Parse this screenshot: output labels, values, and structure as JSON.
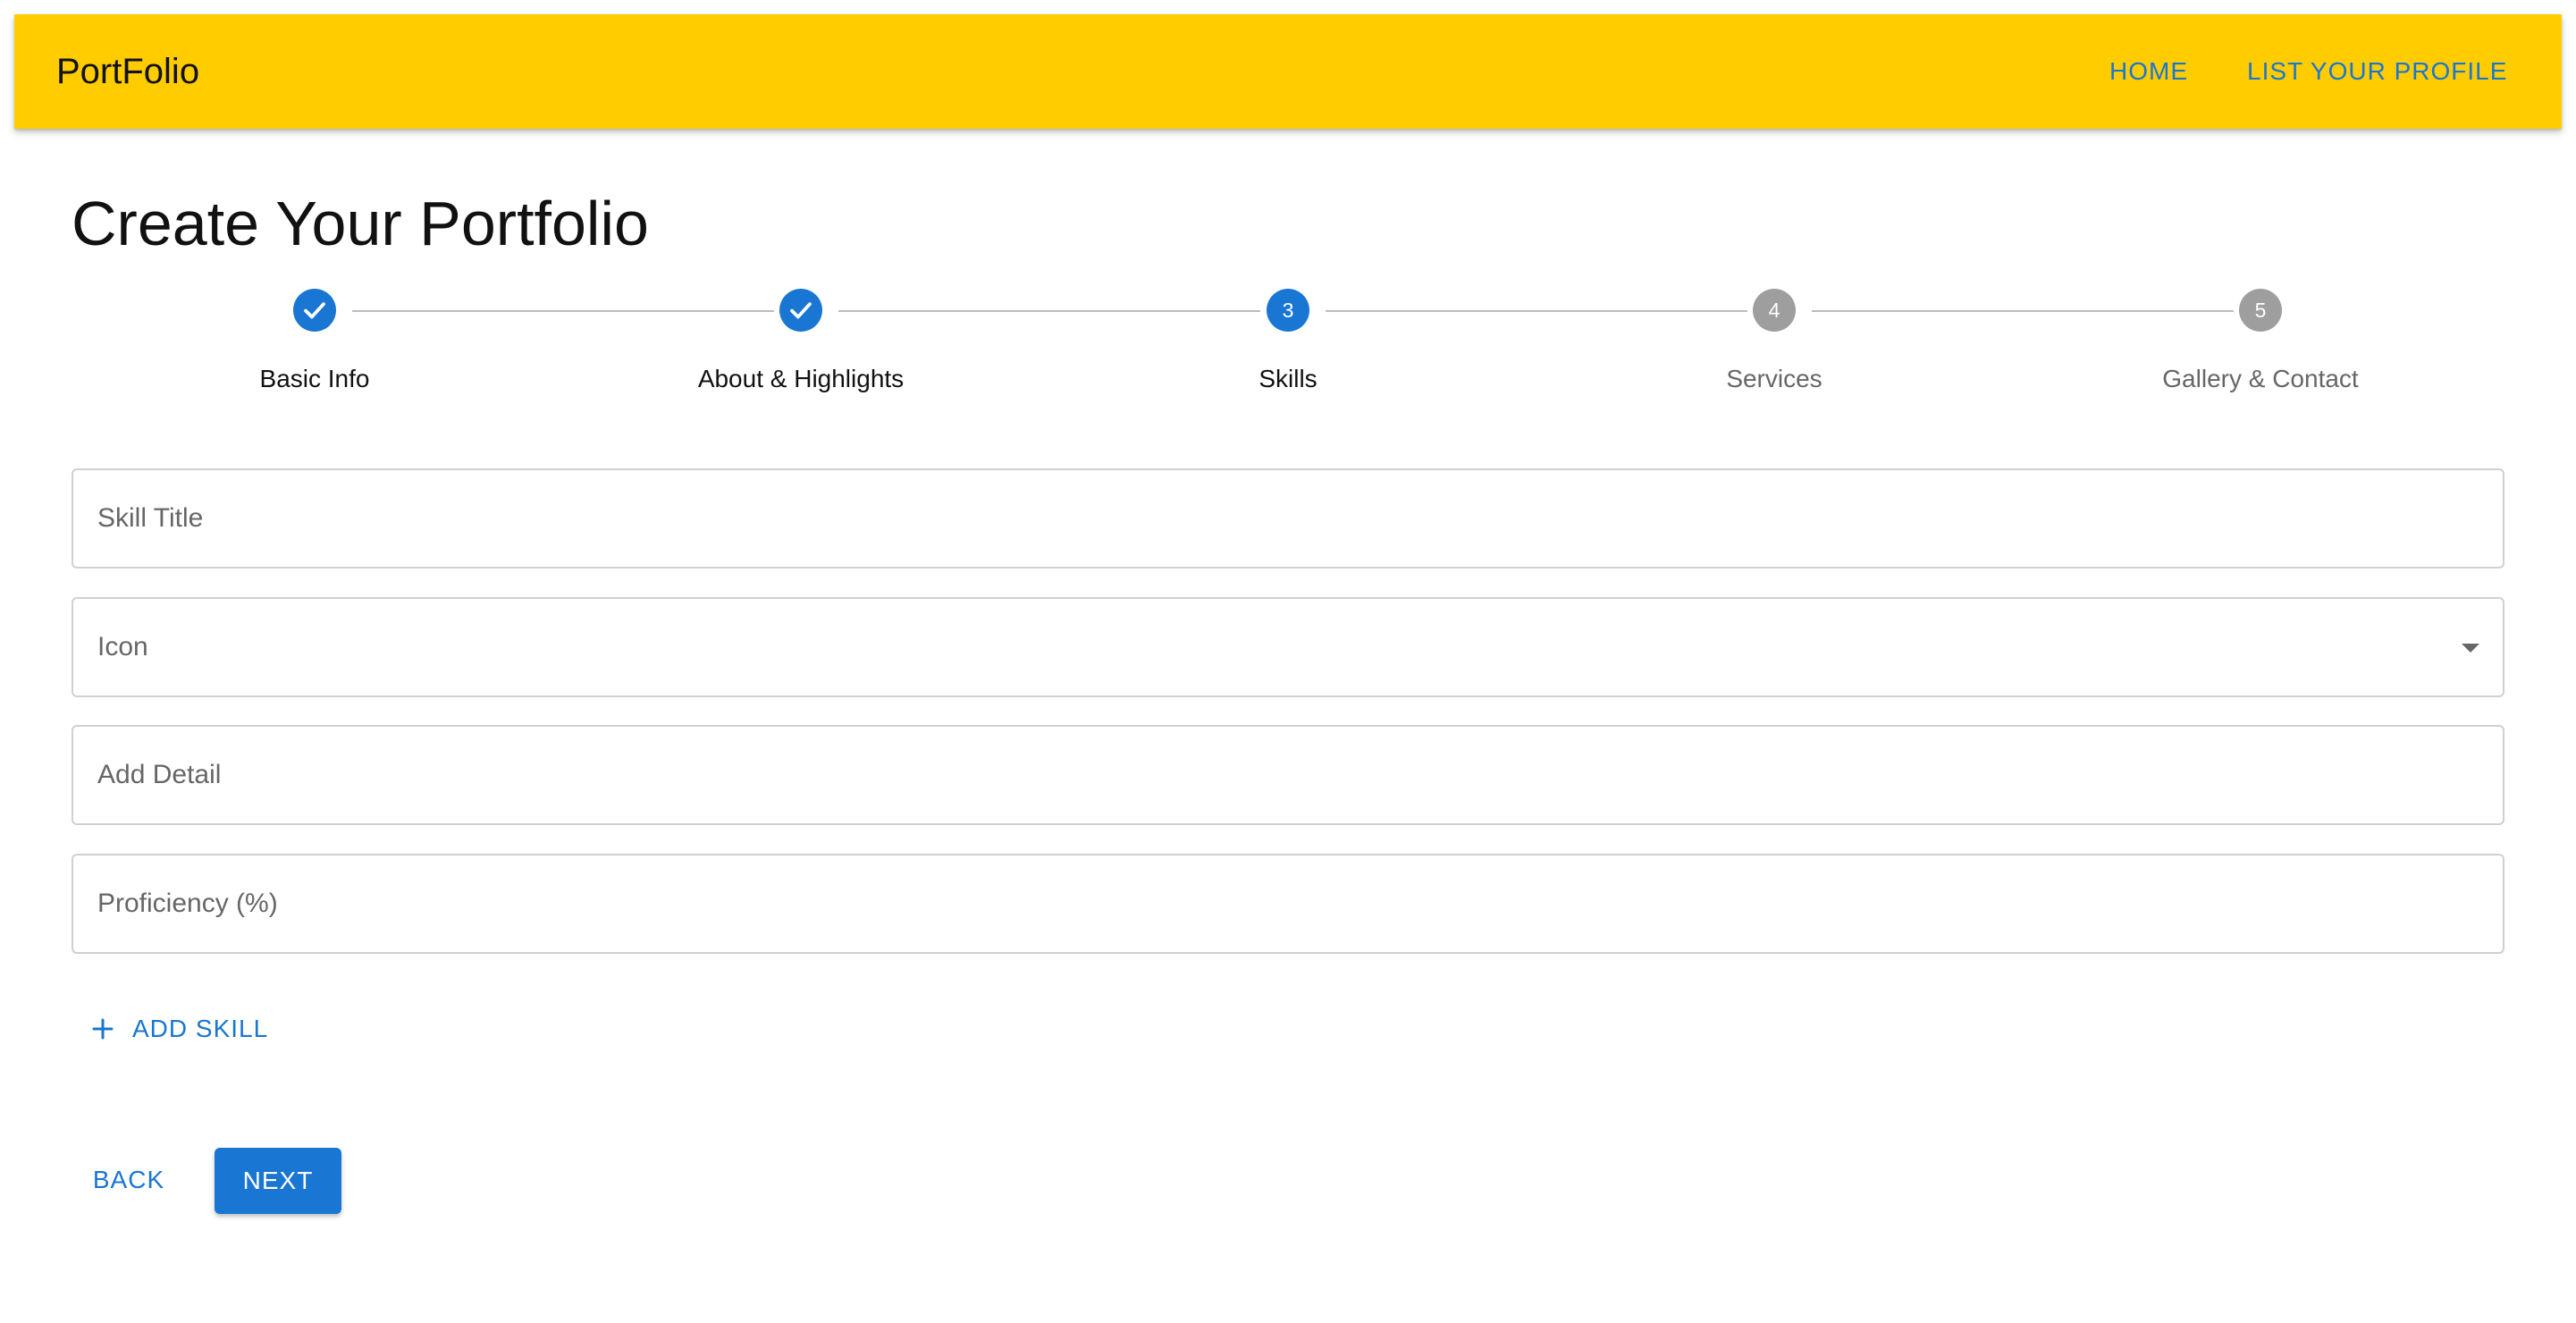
{
  "header": {
    "brand": "PortFolio",
    "nav": [
      "HOME",
      "LIST YOUR PROFILE"
    ],
    "background_color": "#ffcc00",
    "link_color": "#1976d2"
  },
  "page_title": "Create Your Portfolio",
  "stepper": {
    "steps": [
      {
        "label": "Basic Info",
        "state": "completed",
        "marker": "check-icon"
      },
      {
        "label": "About & Highlights",
        "state": "completed",
        "marker": "check-icon"
      },
      {
        "label": "Skills",
        "state": "active",
        "number": "3"
      },
      {
        "label": "Services",
        "state": "pending",
        "number": "4"
      },
      {
        "label": "Gallery & Contact",
        "state": "pending",
        "number": "5"
      }
    ],
    "active_color": "#1976d2",
    "pending_color": "#9e9e9e"
  },
  "form": {
    "skill_title_placeholder": "Skill Title",
    "icon_select_label": "Icon",
    "add_detail_placeholder": "Add Detail",
    "proficiency_placeholder": "Proficiency (%)"
  },
  "actions": {
    "add_skill": "ADD SKILL",
    "back": "BACK",
    "next": "NEXT"
  },
  "icons": {
    "completed_step": "check-icon",
    "add": "plus-icon",
    "select": "chevron-down-icon"
  }
}
